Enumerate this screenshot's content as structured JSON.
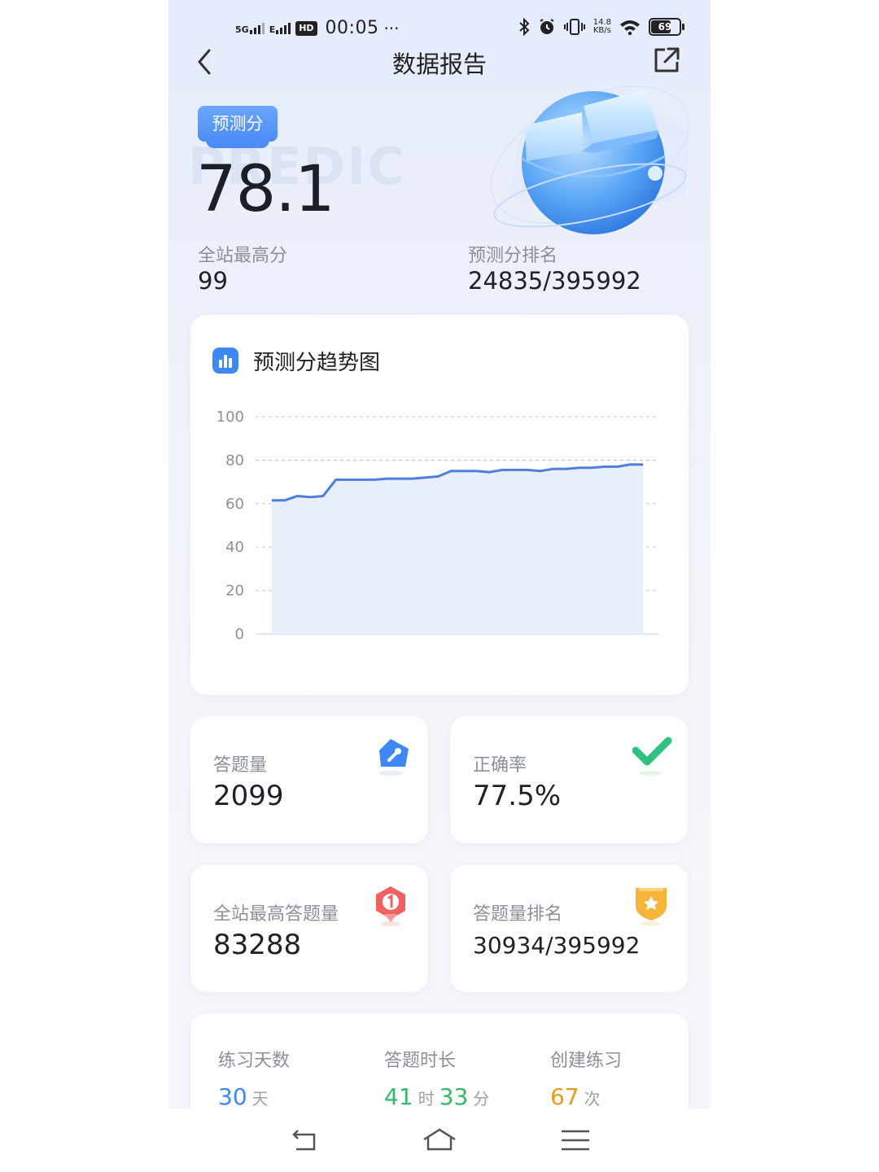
{
  "status_bar": {
    "sig1": "5G",
    "sig2": "E",
    "hd": "HD",
    "time": "00:05",
    "dots": "···",
    "net_speed_value": "14.8",
    "net_speed_unit": "KB/s",
    "battery": "69"
  },
  "header": {
    "title": "数据报告"
  },
  "hero": {
    "badge": "预测分",
    "watermark": "PREDIC",
    "score": "78.1",
    "max_label": "全站最高分",
    "max_value": "99",
    "rank_label": "预测分排名",
    "rank_value": "24835/395992"
  },
  "trend": {
    "title": "预测分趋势图"
  },
  "chart_data": {
    "type": "area",
    "title": "预测分趋势图",
    "ylim": [
      0,
      100
    ],
    "yticks": [
      "100",
      "80",
      "60",
      "40",
      "20",
      "0"
    ],
    "x": [
      1,
      2,
      3,
      4,
      5,
      6,
      7,
      8,
      9,
      10,
      11,
      12,
      13,
      14,
      15,
      16,
      17,
      18,
      19,
      20,
      21,
      22,
      23,
      24,
      25,
      26,
      27,
      28,
      29,
      30
    ],
    "values": [
      61.5,
      61.5,
      63.5,
      63,
      63.5,
      71,
      71,
      71,
      71,
      71.5,
      71.5,
      71.5,
      72,
      72.5,
      75,
      75,
      75,
      74.5,
      75.5,
      75.5,
      75.5,
      75,
      76,
      76,
      76.5,
      76.5,
      77,
      77,
      78,
      78
    ],
    "colors": {
      "line": "#4f7fdc",
      "fill": "#e8eefc",
      "grid": "#c9cfdb"
    },
    "grid": true
  },
  "stats": [
    {
      "label": "答题量",
      "value": "2099",
      "icon": "pencil-icon"
    },
    {
      "label": "正确率",
      "value": "77.5%",
      "icon": "check-icon"
    },
    {
      "label": "全站最高答题量",
      "value": "83288",
      "icon": "rank-one-icon"
    },
    {
      "label": "答题量排名",
      "value": "30934/395992",
      "icon": "shield-star-icon"
    }
  ],
  "summary": {
    "practice_days": {
      "label": "练习天数",
      "value": "30",
      "unit": "天",
      "color": "#3d88f6"
    },
    "duration": {
      "label": "答题时长",
      "hours": "41",
      "hours_unit": "时",
      "minutes": "33",
      "minutes_unit": "分",
      "color": "#34b86a"
    },
    "created": {
      "label": "创建练习",
      "value": "67",
      "unit": "次",
      "color": "#e89a1f"
    }
  }
}
